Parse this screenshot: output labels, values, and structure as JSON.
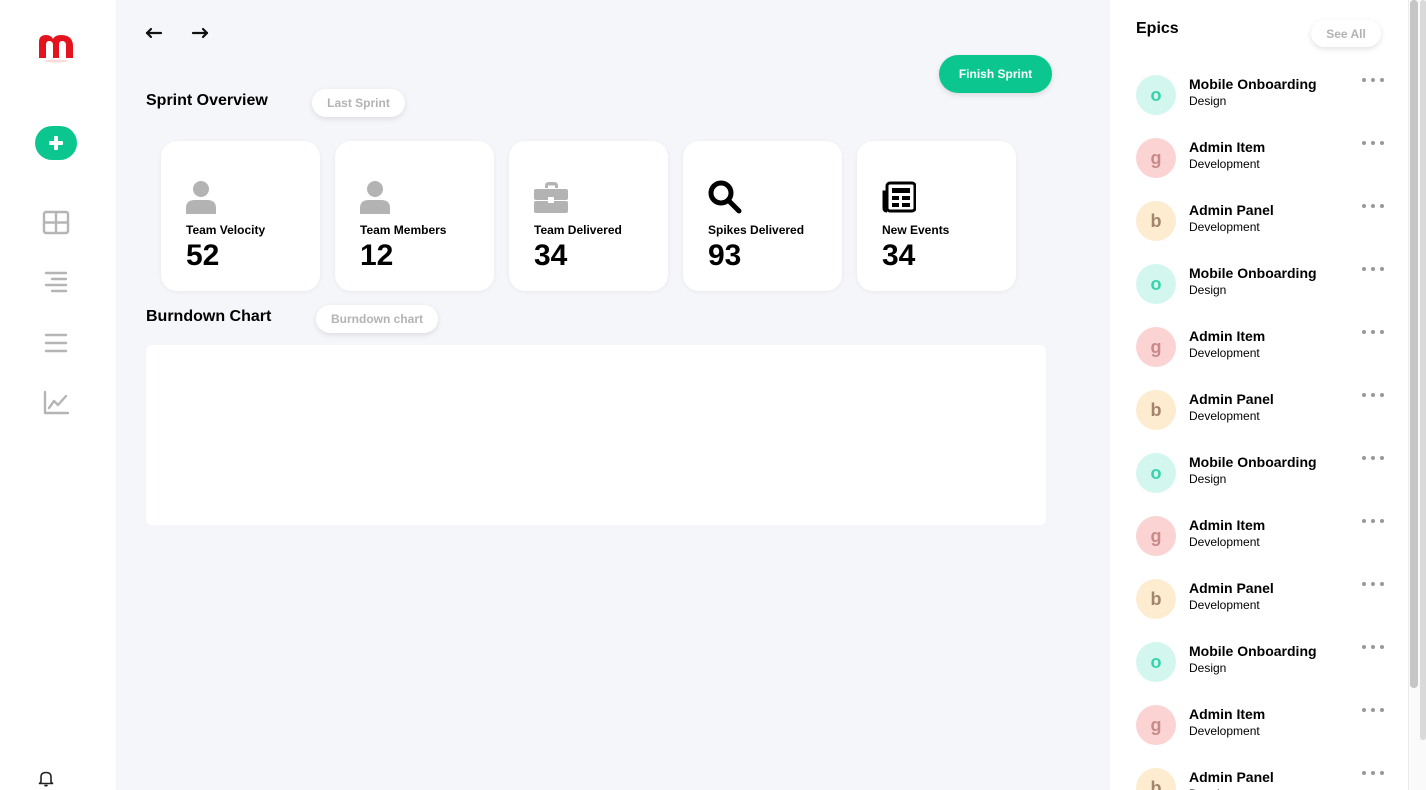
{
  "nav": {
    "logo_letter": "m",
    "brand_color": "#e3141e",
    "accent_color": "#0cc68f",
    "items": [
      "add-icon",
      "dashboard-grid-icon",
      "align-right-icon",
      "menu-lines-icon",
      "line-chart-icon"
    ],
    "bottom_icon": "bell-icon"
  },
  "header": {
    "back_icon": "arrow-left-icon",
    "forward_icon": "arrow-right-icon",
    "finish_label": "Finish Sprint"
  },
  "overview": {
    "title": "Sprint Overview",
    "filter_label": "Last Sprint",
    "stats": [
      {
        "icon": "user-icon",
        "label": "Team Velocity",
        "value": "52"
      },
      {
        "icon": "user-icon",
        "label": "Team Members",
        "value": "12"
      },
      {
        "icon": "briefcase-icon",
        "label": "Team Delivered",
        "value": "34"
      },
      {
        "icon": "search-icon",
        "label": "Spikes Delivered",
        "value": "93"
      },
      {
        "icon": "newspaper-icon",
        "label": "New Events",
        "value": "34"
      }
    ]
  },
  "burndown": {
    "title": "Burndown Chart",
    "filter_label": "Burndown chart"
  },
  "epics": {
    "title": "Epics",
    "see_all_label": "See All",
    "items": [
      {
        "letter": "o",
        "name": "Mobile Onboarding",
        "category": "Design",
        "bg": "#d3f7ee",
        "fg": "#38d2ad"
      },
      {
        "letter": "g",
        "name": "Admin Item",
        "category": "Development",
        "bg": "#fbd3d3",
        "fg": "#c98a8a"
      },
      {
        "letter": "b",
        "name": "Admin Panel",
        "category": "Development",
        "bg": "#fdecd0",
        "fg": "#a3856b"
      },
      {
        "letter": "o",
        "name": "Mobile Onboarding",
        "category": "Design",
        "bg": "#d3f7ee",
        "fg": "#38d2ad"
      },
      {
        "letter": "g",
        "name": "Admin Item",
        "category": "Development",
        "bg": "#fbd3d3",
        "fg": "#c98a8a"
      },
      {
        "letter": "b",
        "name": "Admin Panel",
        "category": "Development",
        "bg": "#fdecd0",
        "fg": "#a3856b"
      },
      {
        "letter": "o",
        "name": "Mobile Onboarding",
        "category": "Design",
        "bg": "#d3f7ee",
        "fg": "#38d2ad"
      },
      {
        "letter": "g",
        "name": "Admin Item",
        "category": "Development",
        "bg": "#fbd3d3",
        "fg": "#c98a8a"
      },
      {
        "letter": "b",
        "name": "Admin Panel",
        "category": "Development",
        "bg": "#fdecd0",
        "fg": "#a3856b"
      },
      {
        "letter": "o",
        "name": "Mobile Onboarding",
        "category": "Design",
        "bg": "#d3f7ee",
        "fg": "#38d2ad"
      },
      {
        "letter": "g",
        "name": "Admin Item",
        "category": "Development",
        "bg": "#fbd3d3",
        "fg": "#c98a8a"
      },
      {
        "letter": "b",
        "name": "Admin Panel",
        "category": "Development",
        "bg": "#fdecd0",
        "fg": "#a3856b"
      }
    ]
  }
}
